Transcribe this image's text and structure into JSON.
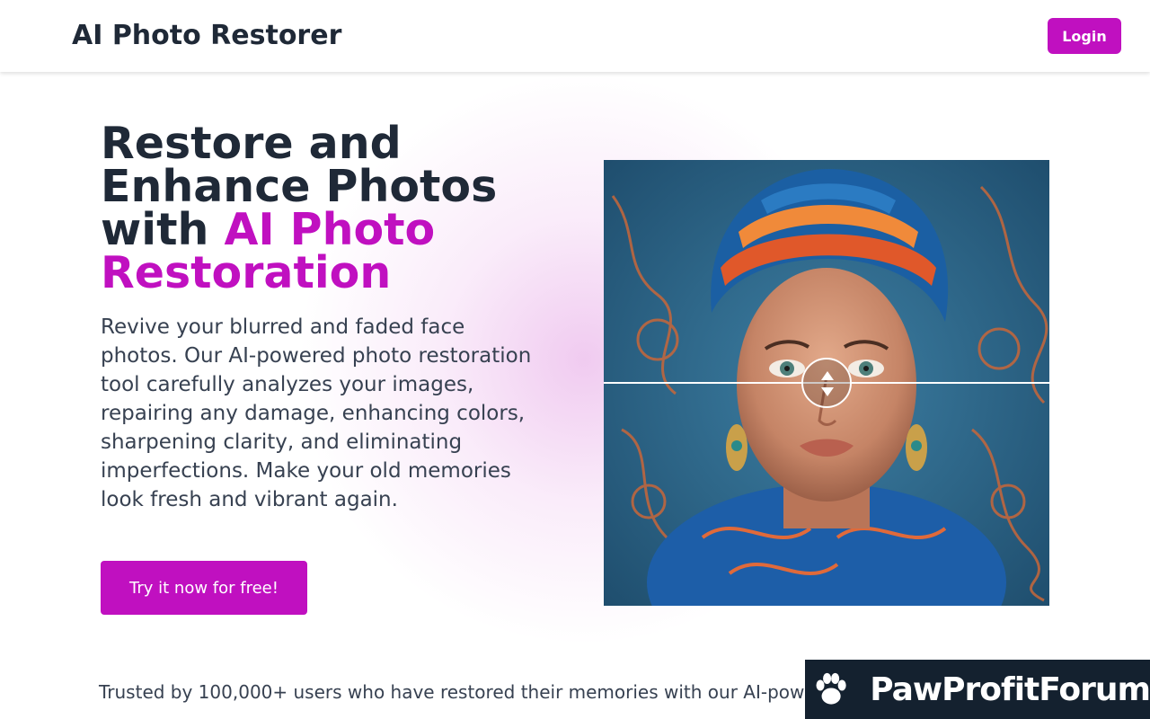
{
  "header": {
    "brand": "AI Photo Restorer",
    "login_label": "Login"
  },
  "hero": {
    "title_plain": "Restore and Enhance Photos with",
    "title_accent": "AI Photo Restoration",
    "description": "Revive your blurred and faded face photos. Our AI-powered photo restoration tool carefully analyzes your images, repairing any damage, enhancing colors, sharpening clarity, and eliminating imperfections. Make your old memories look fresh and vibrant again.",
    "cta_label": "Try it now for free!"
  },
  "comparison": {
    "slider_position": 0.5,
    "handle_icon": "up-down-arrows-icon"
  },
  "trusted": {
    "text": "Trusted by 100,000+ users who have restored their memories with our AI-pow"
  },
  "watermark": {
    "text": "PawProfitForum",
    "icon": "paw-icon"
  },
  "colors": {
    "accent": "#c010c0",
    "heading": "#1f2937",
    "body_text": "#374151",
    "watermark_bg": "#14212f"
  }
}
